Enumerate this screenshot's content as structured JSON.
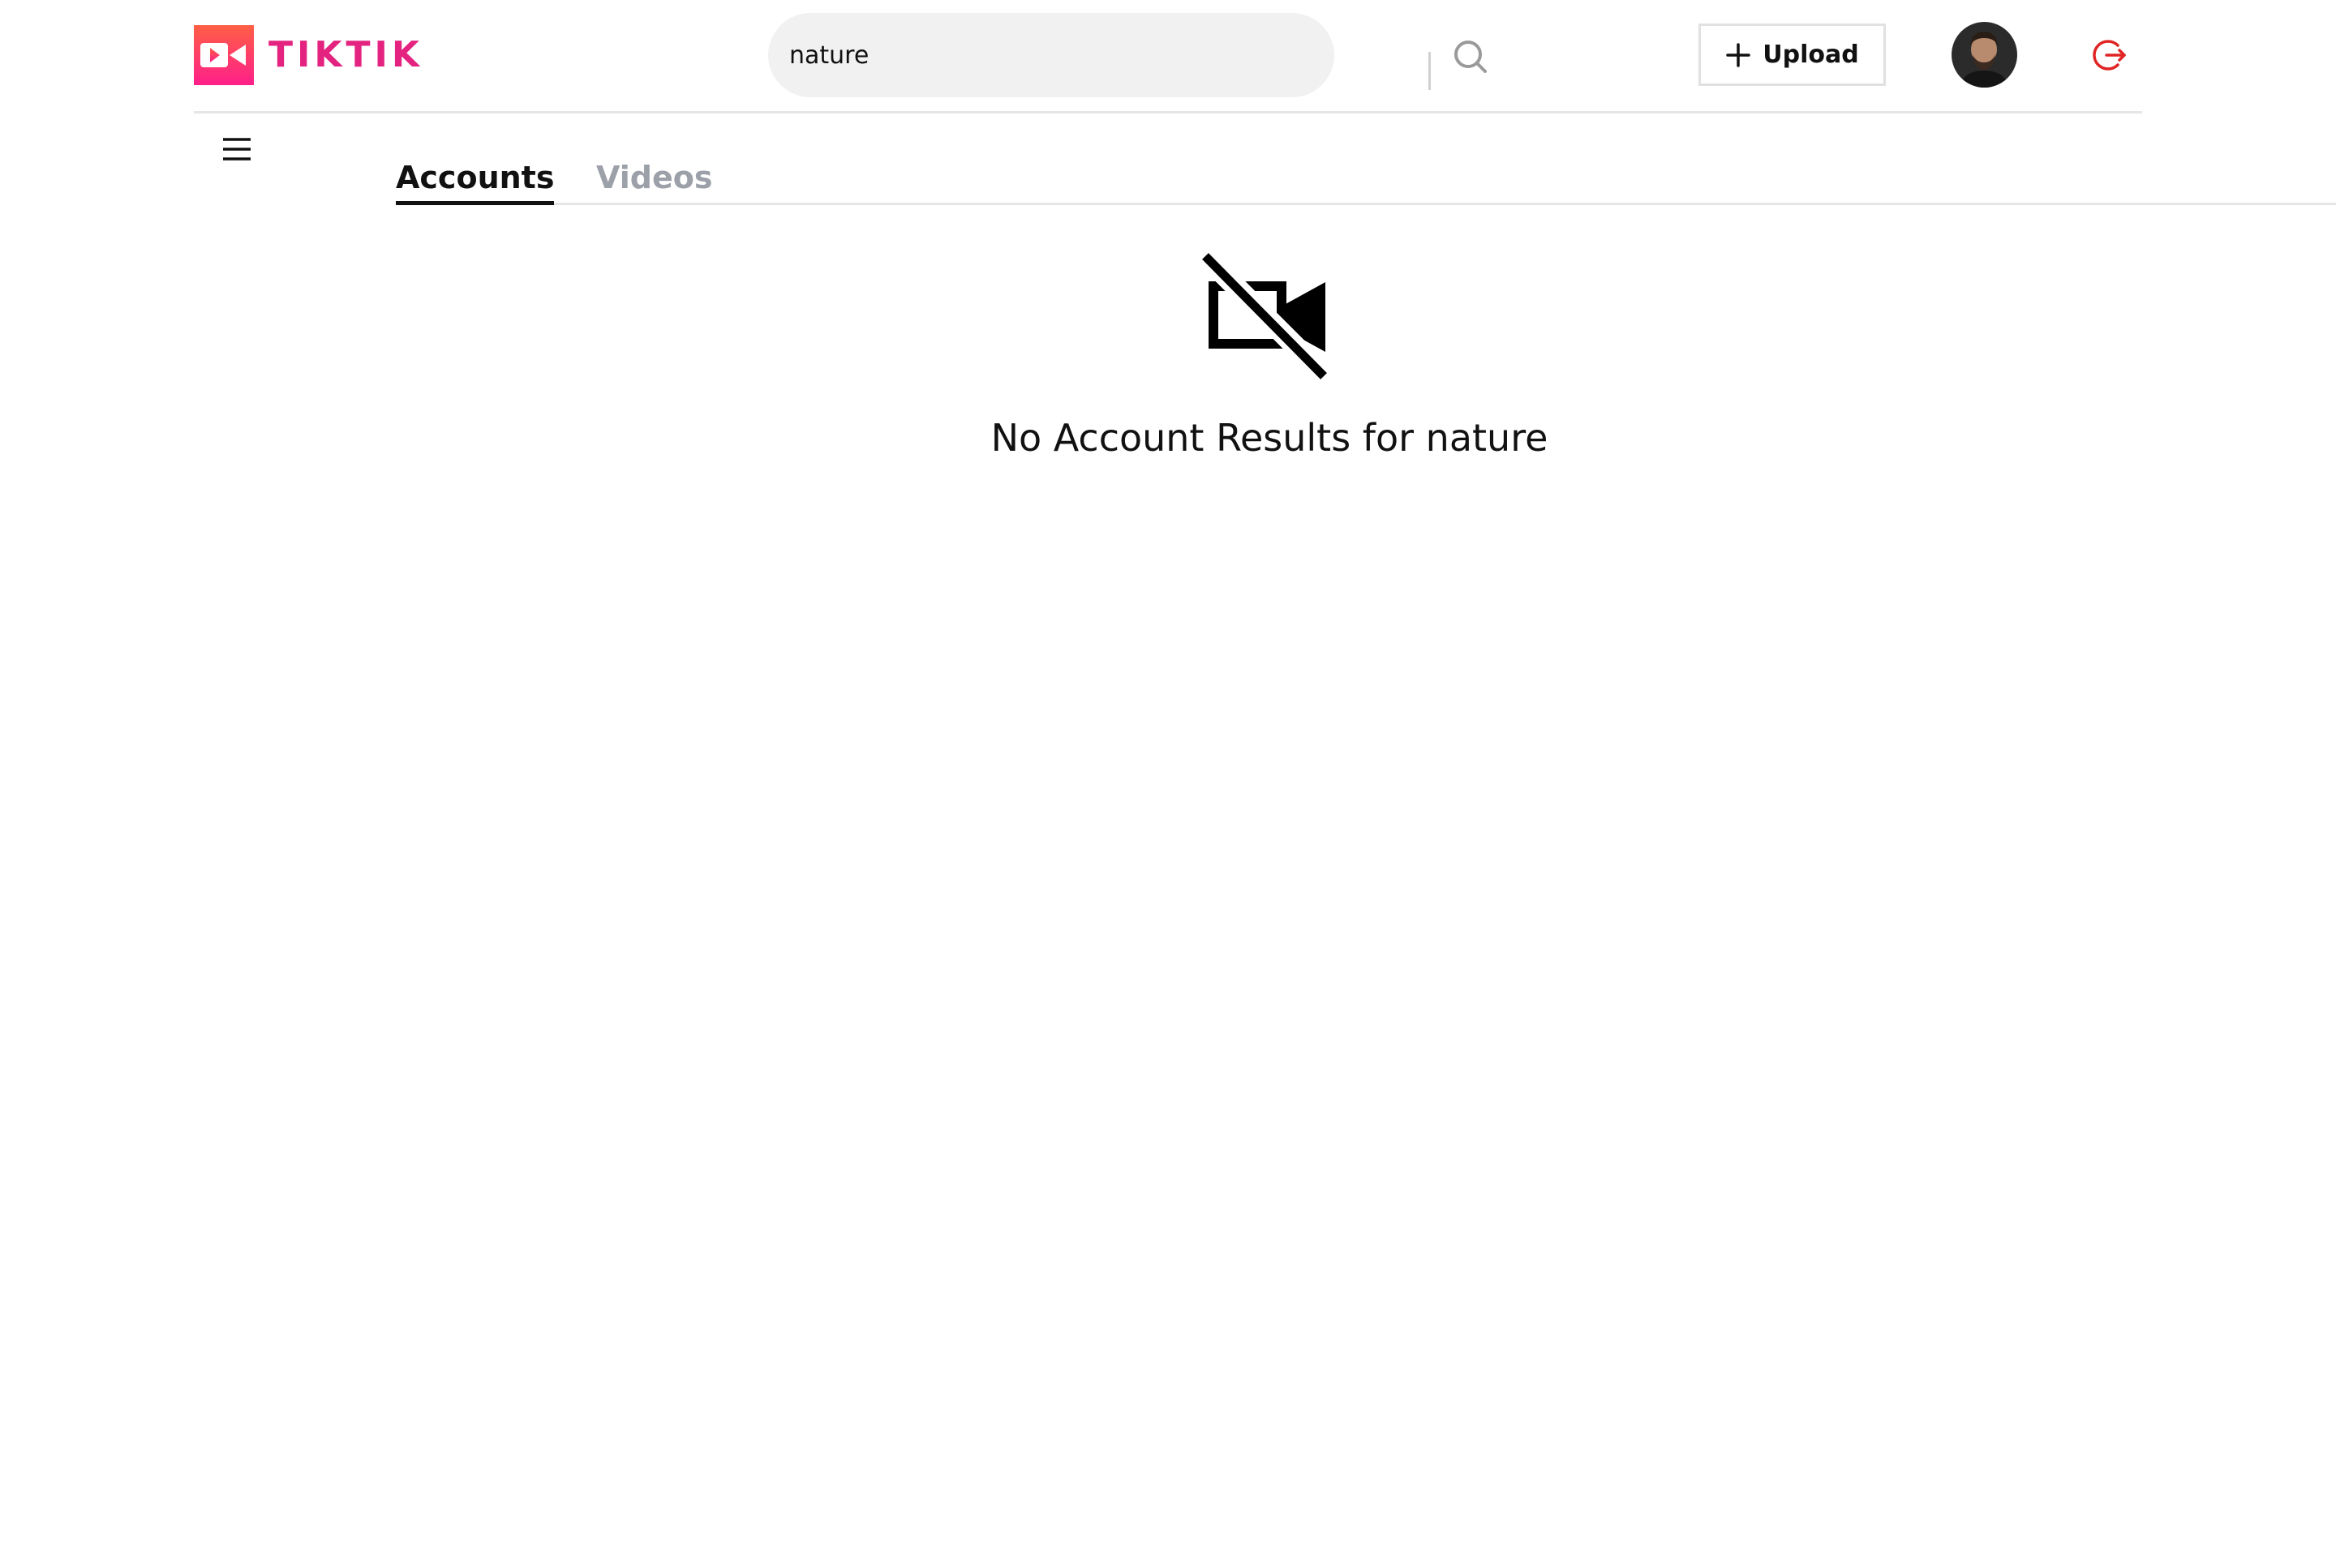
{
  "app": {
    "brand_name": "TIKTIK",
    "brand_color": "#e4227f"
  },
  "navbar": {
    "search": {
      "value": "nature",
      "icon": "search-icon"
    },
    "upload_label": "Upload",
    "upload_icon": "plus-icon",
    "avatar_icon": "user-avatar",
    "logout_icon": "logout-icon",
    "logout_color": "#e02424"
  },
  "sidebar": {
    "toggle_icon": "menu-icon"
  },
  "tabs": [
    {
      "label": "Accounts",
      "active": true
    },
    {
      "label": "Videos",
      "active": false
    }
  ],
  "empty_state": {
    "icon": "video-off-icon",
    "message": "No Account Results for nature"
  }
}
